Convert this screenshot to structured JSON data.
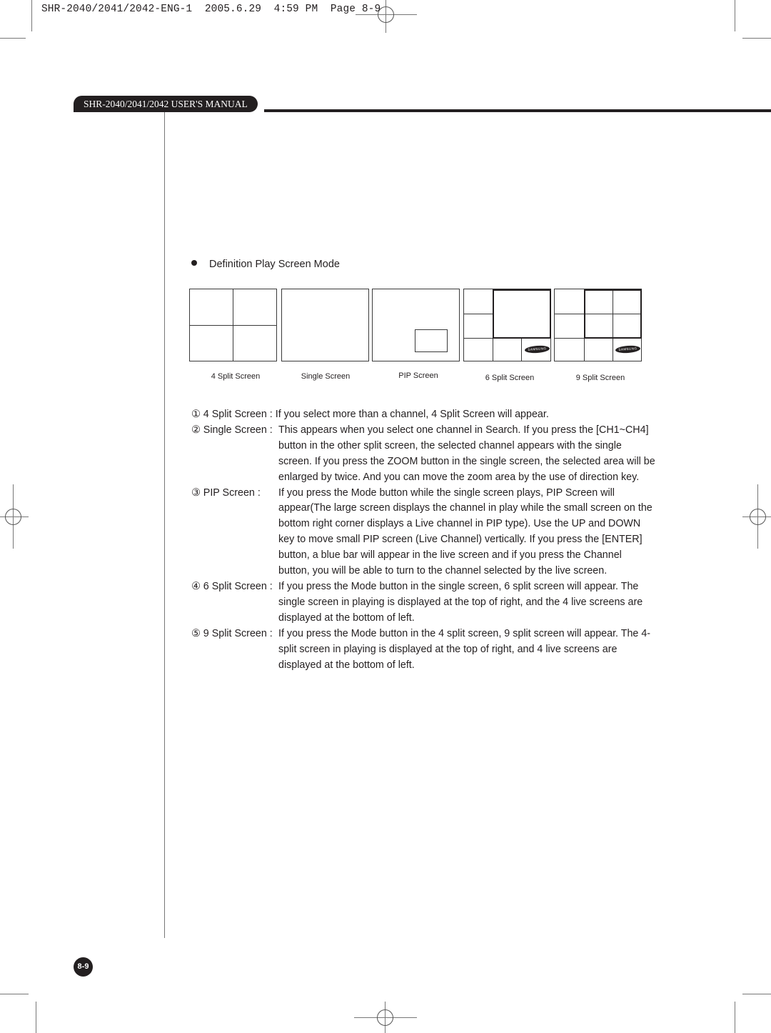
{
  "print_header": "SHR-2040/2041/2042-ENG-1  2005.6.29  4:59 PM  Page 8-9",
  "manual_title": "SHR-2040/2041/2042 USER'S MANUAL",
  "section": {
    "bullet_icon": "filled-circle",
    "title": "Definition Play Screen Mode"
  },
  "diagrams": [
    {
      "caption": "4 Split Screen"
    },
    {
      "caption": "Single Screen"
    },
    {
      "caption": "PIP Screen"
    },
    {
      "caption": "6 Split Screen",
      "logo": "SAMSUNG"
    },
    {
      "caption": "9 Split Screen",
      "logo": "SAMSUNG"
    }
  ],
  "descriptions": [
    {
      "label": "① 4 Split Screen :",
      "text": "If you select more than a channel, 4 Split Screen will appear."
    },
    {
      "label": "② Single Screen :",
      "text": "This appears when you select one channel in Search. If you press the [CH1~CH4] button in the other split screen, the selected channel appears with the single screen. If you press the ZOOM button in the single screen, the selected area will be enlarged by twice. And you can move the zoom area by the use of direction key."
    },
    {
      "label": "③ PIP Screen :",
      "text": "If you press the Mode button while the single screen plays, PIP Screen will appear(The large screen displays the channel in play while the small screen on the bottom right corner displays a Live channel in PIP type). Use the UP and DOWN key to move small PIP screen (Live Channel) vertically. If you press the [ENTER] button, a blue bar will appear in the live screen and if you press the Channel button, you will be able to turn to the channel selected by the live screen."
    },
    {
      "label": "④ 6 Split Screen :",
      "text": "If you press the Mode button in the single screen, 6 split screen will appear. The single screen in playing is displayed at the top of right, and the 4 live screens are displayed at the bottom of left."
    },
    {
      "label": "⑤ 9 Split Screen :",
      "text": "If you press the Mode button in the 4 split screen, 9 split screen will appear. The 4-split screen in playing is displayed at the top of right, and 4 live screens are displayed at the bottom of left."
    }
  ],
  "page_number": "8-9",
  "colors": {
    "ink": "#231f20",
    "rule": "#777777"
  }
}
